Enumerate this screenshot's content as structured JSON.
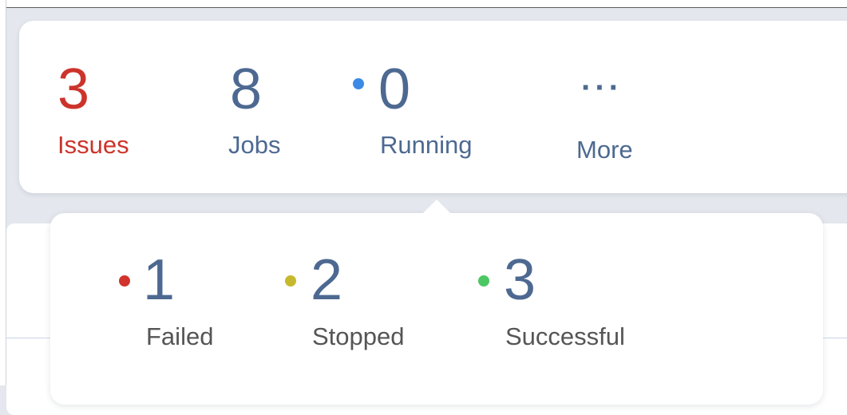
{
  "summary": {
    "issues": {
      "count": "3",
      "label": "Issues"
    },
    "jobs": {
      "count": "8",
      "label": "Jobs"
    },
    "running": {
      "count": "0",
      "label": "Running"
    },
    "more": {
      "label": "More",
      "icon": "more-dots-icon"
    }
  },
  "jobs_breakdown": {
    "failed": {
      "count": "1",
      "label": "Failed"
    },
    "stopped": {
      "count": "2",
      "label": "Stopped"
    },
    "successful": {
      "count": "3",
      "label": "Successful"
    }
  },
  "colors": {
    "issues_red": "#cc342b",
    "text_blue": "#4d6991",
    "label_gray": "#555555",
    "running_dot": "#3c8ae6",
    "failed_dot": "#d0342c",
    "stopped_dot": "#c7b92e",
    "successful_dot": "#4cc763"
  }
}
